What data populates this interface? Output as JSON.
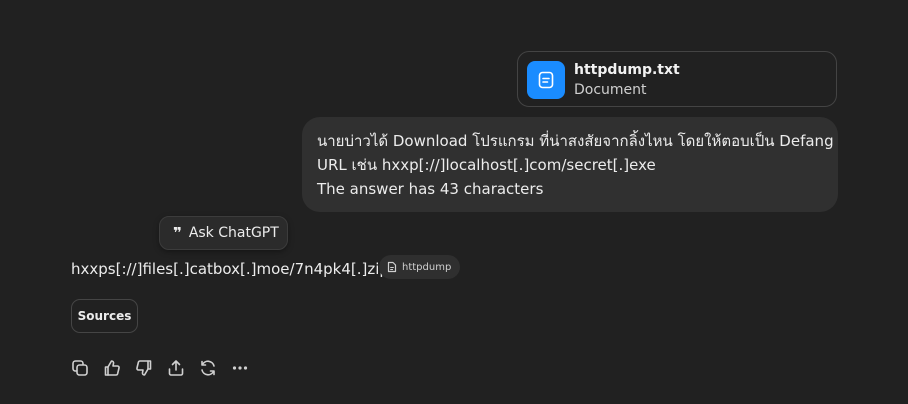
{
  "attachment": {
    "file_name": "httpdump.txt",
    "file_type": "Document",
    "icon": "document-icon",
    "accent_color": "#1a8cff"
  },
  "user_message": {
    "lines": [
      "นายบ่าวได้ Download โปรแกรม ที่น่าสงสัยจากลิ้งไหน โดยให้ตอบเป็น Defang",
      "URL เช่น hxxp[://]localhost[.]com/secret[.]exe",
      "The answer has 43 characters"
    ]
  },
  "ask_chatgpt": {
    "label": "Ask ChatGPT",
    "icon": "quote-icon"
  },
  "assistant_answer": {
    "text": "hxxps[://]files[.]catbox[.]moe/7n4pk4[.]zip",
    "citation": {
      "label": "httpdump",
      "icon": "file-icon"
    }
  },
  "sources_button": {
    "label": "Sources"
  },
  "actions": [
    {
      "name": "copy-icon"
    },
    {
      "name": "thumbs-up-icon"
    },
    {
      "name": "thumbs-down-icon"
    },
    {
      "name": "share-icon"
    },
    {
      "name": "regenerate-icon"
    },
    {
      "name": "more-icon"
    }
  ]
}
